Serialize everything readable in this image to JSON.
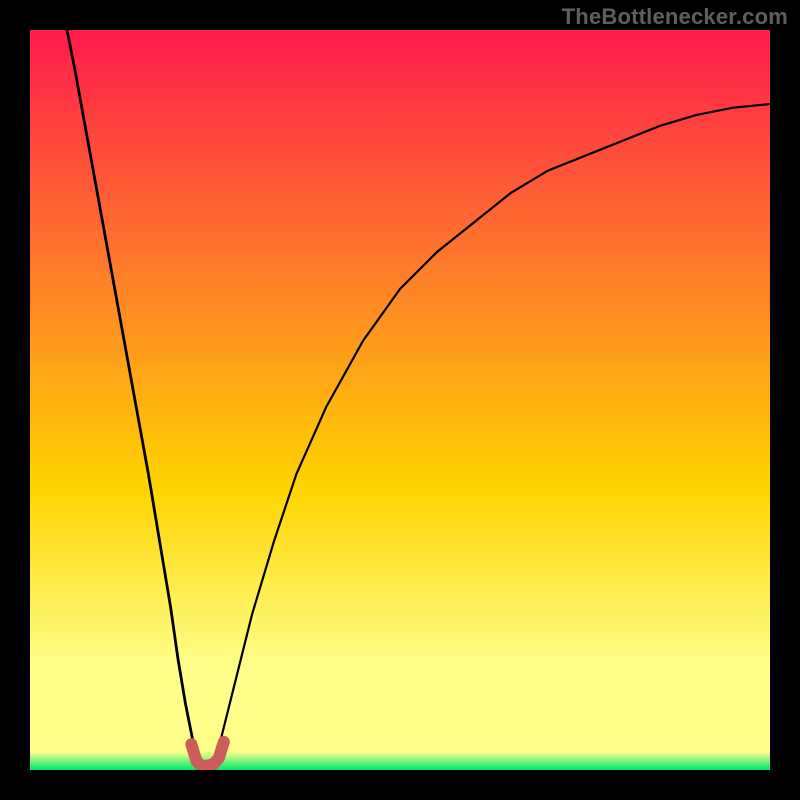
{
  "watermark": "TheBottlenecker.com",
  "colors": {
    "frame": "#000000",
    "top_red": "#ff1b4b",
    "mid_orange": "#ff7b2a",
    "mid_yellow": "#ffd400",
    "pale_yellow": "#ffff8a",
    "bottom_green": "#00e871",
    "curve": "#000000",
    "highlight": "#cd5c5c"
  },
  "chart_data": {
    "type": "line",
    "title": "",
    "xlabel": "",
    "ylabel": "",
    "xlim": [
      0,
      100
    ],
    "ylim": [
      0,
      100
    ],
    "grid": false,
    "legend": false,
    "series": [
      {
        "name": "left-branch",
        "x": [
          5,
          6,
          8,
          10,
          12,
          14,
          16,
          18,
          19,
          20,
          21,
          22,
          22.5
        ],
        "values": [
          100,
          95,
          84,
          73,
          62,
          51,
          40,
          28,
          22,
          15,
          9,
          4,
          1
        ]
      },
      {
        "name": "right-branch",
        "x": [
          25,
          26,
          28,
          30,
          33,
          36,
          40,
          45,
          50,
          55,
          60,
          65,
          70,
          75,
          80,
          85,
          90,
          95,
          100
        ],
        "values": [
          1,
          5,
          13,
          21,
          31,
          40,
          49,
          58,
          65,
          70,
          74,
          78,
          81,
          83,
          85,
          87,
          88.5,
          89.5,
          90
        ]
      },
      {
        "name": "minimum-highlight",
        "x": [
          21.8,
          22.5,
          23.2,
          24.0,
          24.8,
          25.5,
          26.2
        ],
        "values": [
          3.5,
          1.2,
          0.5,
          0.6,
          0.8,
          1.6,
          3.8
        ]
      }
    ],
    "annotations": []
  }
}
